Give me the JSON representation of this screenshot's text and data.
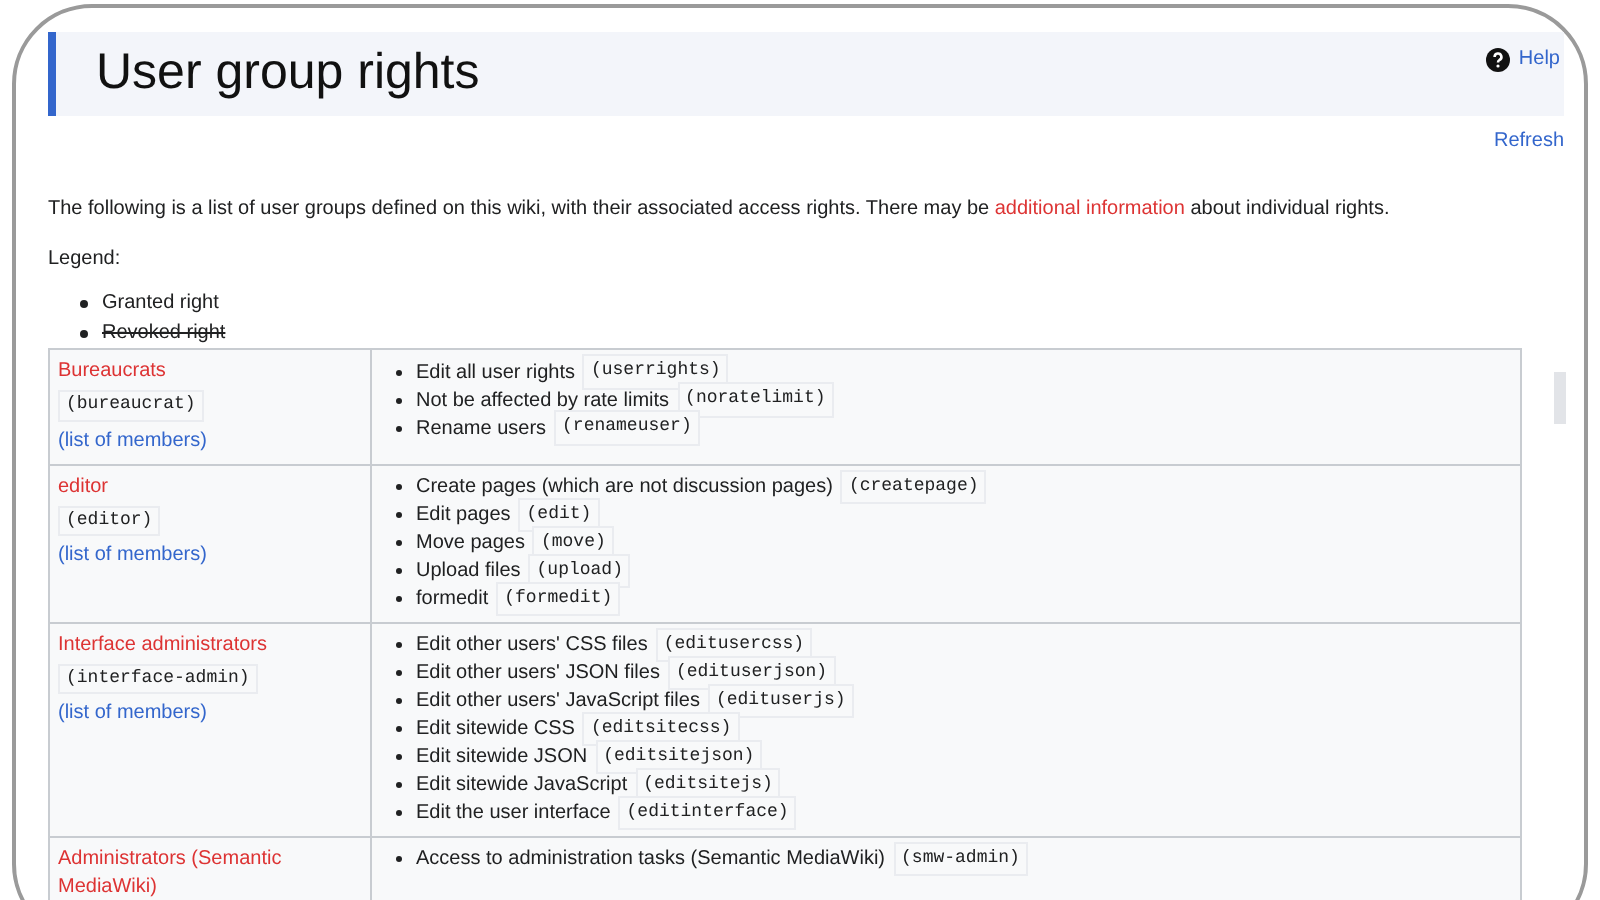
{
  "header": {
    "title": "User group rights",
    "help": "Help"
  },
  "refresh": "Refresh",
  "intro": {
    "before": "The following is a list of user groups defined on this wiki, with their associated access rights. There may be ",
    "link": "additional information",
    "after": " about individual rights."
  },
  "legend": {
    "label": "Legend:",
    "items": [
      {
        "text": "Granted right",
        "kind": "granted"
      },
      {
        "text": "Revoked right",
        "kind": "revoked"
      }
    ]
  },
  "groups": [
    {
      "name": "Bureaucrats",
      "code": "(bureaucrat)",
      "members": "(list of members)",
      "rights": [
        {
          "text": "Edit all user rights",
          "code": "(userrights)"
        },
        {
          "text": "Not be affected by rate limits",
          "code": "(noratelimit)"
        },
        {
          "text": "Rename users",
          "code": "(renameuser)"
        }
      ]
    },
    {
      "name": "editor",
      "code": "(editor)",
      "members": "(list of members)",
      "rights": [
        {
          "text": "Create pages (which are not discussion pages)",
          "code": "(createpage)"
        },
        {
          "text": "Edit pages",
          "code": "(edit)"
        },
        {
          "text": "Move pages",
          "code": "(move)"
        },
        {
          "text": "Upload files",
          "code": "(upload)"
        },
        {
          "text": "formedit",
          "code": "(formedit)"
        }
      ]
    },
    {
      "name": "Interface administrators",
      "code": "(interface-admin)",
      "members": "(list of members)",
      "rights": [
        {
          "text": "Edit other users' CSS files",
          "code": "(editusercss)"
        },
        {
          "text": "Edit other users' JSON files",
          "code": "(edituserjson)"
        },
        {
          "text": "Edit other users' JavaScript files",
          "code": "(edituserjs)"
        },
        {
          "text": "Edit sitewide CSS",
          "code": "(editsitecss)"
        },
        {
          "text": "Edit sitewide JSON",
          "code": "(editsitejson)"
        },
        {
          "text": "Edit sitewide JavaScript",
          "code": "(editsitejs)"
        },
        {
          "text": "Edit the user interface",
          "code": "(editinterface)"
        }
      ]
    },
    {
      "name": "Administrators (Semantic MediaWiki)",
      "rights": [
        {
          "text": "Access to administration tasks (Semantic MediaWiki)",
          "code": "(smw-admin)"
        }
      ]
    }
  ]
}
